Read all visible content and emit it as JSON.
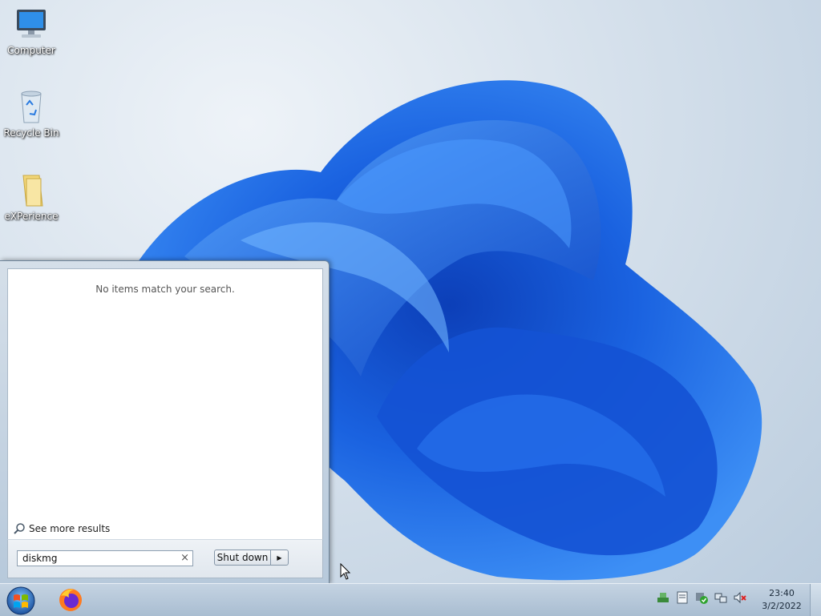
{
  "desktop": {
    "icons": [
      {
        "label": "Computer",
        "icon": "computer-icon"
      },
      {
        "label": "Recycle Bin",
        "icon": "recycle-bin-icon"
      },
      {
        "label": "eXPerience",
        "icon": "folder-icon"
      }
    ]
  },
  "start_menu": {
    "no_results_text": "No items match your search.",
    "see_more_label": "See more results",
    "search": {
      "value": "diskmg",
      "clear_icon": "×"
    },
    "shutdown_label": "Shut down",
    "shutdown_arrow": "▶"
  },
  "taskbar": {
    "pinned": [
      {
        "icon": "firefox-icon"
      }
    ],
    "tray_icons": [
      "network-icon",
      "document-icon",
      "security-icon",
      "connection-icon",
      "volume-muted-icon"
    ],
    "clock": {
      "time": "23:40",
      "date": "3/2/2022"
    }
  },
  "colors": {
    "accent": "#1f6fe0",
    "wallpaper_bloom": "#1a5fd9"
  }
}
